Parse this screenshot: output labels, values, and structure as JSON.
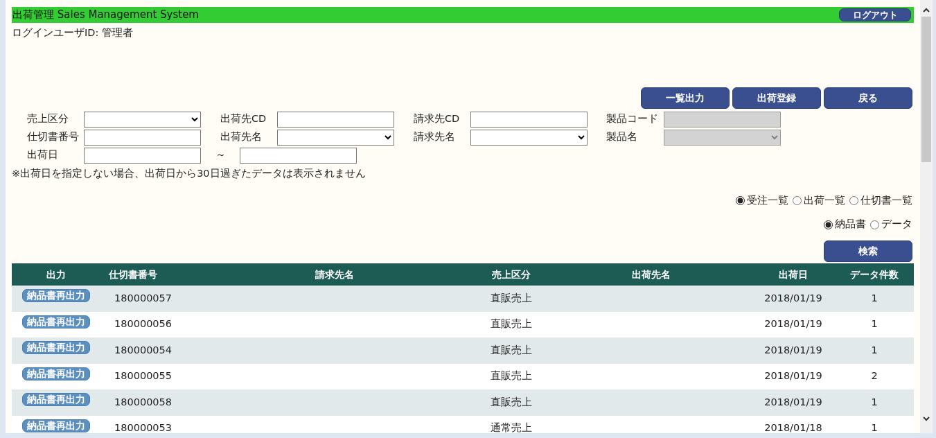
{
  "header": {
    "title": "出荷管理 Sales Management System",
    "logout_button": "ログアウト"
  },
  "login_user": "ログインユーザID: 管理者",
  "action_buttons": [
    "一覧出力",
    "出荷登録",
    "戻る"
  ],
  "filters": [
    {
      "label": "売上区分",
      "kind": "select",
      "disabled": false
    },
    {
      "label": "出荷先CD",
      "kind": "text",
      "disabled": false
    },
    {
      "label": "請求先CD",
      "kind": "text",
      "disabled": false
    },
    {
      "label": "製品コード",
      "kind": "text",
      "disabled": true
    },
    {
      "label": "仕切書番号",
      "kind": "text",
      "disabled": false
    },
    {
      "label": "出荷先名",
      "kind": "select",
      "disabled": false
    },
    {
      "label": "請求先名",
      "kind": "select",
      "disabled": false
    },
    {
      "label": "製品名",
      "kind": "select",
      "disabled": true
    },
    {
      "label": "出荷日",
      "kind": "range",
      "separator": "～"
    }
  ],
  "note": "※出荷日を指定しない場合、出荷日から30日過ぎたデータは表示されません",
  "list_type": [
    {
      "label": "受注一覧",
      "selected": true
    },
    {
      "label": "出荷一覧",
      "selected": false
    },
    {
      "label": "仕切書一覧",
      "selected": false
    }
  ],
  "output_type": [
    {
      "label": "納品書",
      "selected": true
    },
    {
      "label": "データ",
      "selected": false
    }
  ],
  "search_button": "検索",
  "table": {
    "columns": [
      "出力",
      "仕切書番号",
      "請求先名",
      "売上区分",
      "出荷先名",
      "出荷日",
      "データ件数"
    ],
    "rows": [
      {
        "button": "納品書再出力",
        "number": "180000057",
        "category": "直販売上",
        "date": "2018/01/19",
        "count": "1"
      },
      {
        "button": "納品書再出力",
        "number": "180000056",
        "category": "直販売上",
        "date": "2018/01/19",
        "count": "1"
      },
      {
        "button": "納品書再出力",
        "number": "180000054",
        "category": "直販売上",
        "date": "2018/01/19",
        "count": "1"
      },
      {
        "button": "納品書再出力",
        "number": "180000055",
        "category": "直販売上",
        "date": "2018/01/19",
        "count": "2"
      },
      {
        "button": "納品書再出力",
        "number": "180000058",
        "category": "直販売上",
        "date": "2018/01/19",
        "count": "1"
      },
      {
        "button": "納品書再出力",
        "number": "180000053",
        "category": "通常売上",
        "date": "2018/01/18",
        "count": "1"
      }
    ]
  }
}
